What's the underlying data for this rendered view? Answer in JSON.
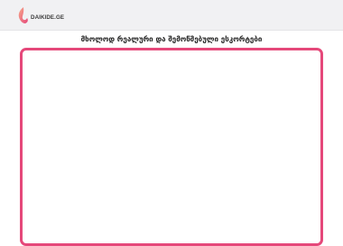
{
  "header": {
    "logo_text": "DAIKIDE.GE",
    "logo_icon": "flame-logo-icon",
    "accent_color": "#e5487a"
  },
  "main": {
    "title": "მხოლოდ რეალური და შემოწმებული ესკორტები"
  }
}
